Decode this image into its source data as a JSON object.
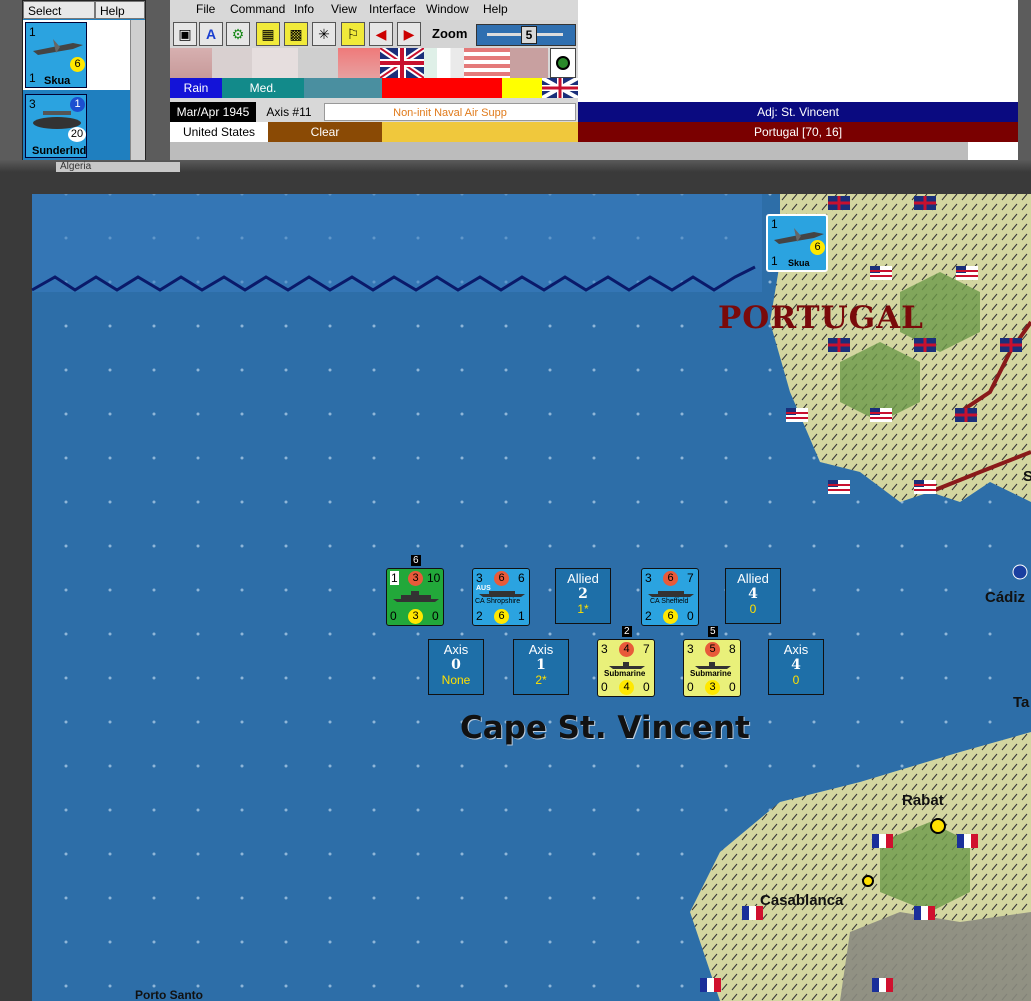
{
  "select_panel": {
    "select_label": "Select",
    "help_label": "Help",
    "units": [
      {
        "name": "Skua",
        "top_left": "1",
        "bottom_left": "1",
        "badge": "6"
      },
      {
        "name": "Sunderlnd",
        "top_left": "3",
        "top_right": "1",
        "badge": "20"
      }
    ]
  },
  "menubar": [
    "File",
    "Command",
    "Info",
    "View",
    "Interface",
    "Window",
    "Help"
  ],
  "toolbar": {
    "zoom_label": "Zoom",
    "zoom_value": "5"
  },
  "weather": {
    "condition": "Rain",
    "zone": "Med."
  },
  "status": {
    "date": "Mar/Apr 1945",
    "turn": "Axis #11",
    "phase": "Non-init Naval Air Supp",
    "adjacent": "Adj: St. Vincent",
    "country": "United States",
    "terrain": "Clear",
    "location": "Portugal [70, 16]"
  },
  "tab_label": "Algeria",
  "map_labels": {
    "country": "PORTUGAL",
    "sea_zone": "Cape St. Vincent",
    "cities": [
      "Rabat",
      "Casablanca",
      "Cádiz",
      "Porto Santo"
    ],
    "partial": [
      "S",
      "Ta"
    ]
  },
  "map_unit": {
    "name": "Skua",
    "top_left": "1",
    "bottom_left": "1",
    "badge": "6"
  },
  "boxes": [
    {
      "side": "Allied",
      "value": "2",
      "extra": "1*"
    },
    {
      "side": "Allied",
      "value": "4",
      "extra": "0"
    },
    {
      "side": "Axis",
      "value": "0",
      "extra": "None"
    },
    {
      "side": "Axis",
      "value": "1",
      "extra": "2*"
    },
    {
      "side": "Axis",
      "value": "4",
      "extra": "0"
    }
  ],
  "ships": [
    {
      "name": "",
      "tl": "1",
      "tm": "3",
      "tr": "10",
      "bl": "0",
      "bm": "3",
      "br": "0",
      "stack": "6"
    },
    {
      "name": "CA Shropshire",
      "prefix": "AUS",
      "tl": "3",
      "tm": "6",
      "tr": "6",
      "bl": "2",
      "bm": "6",
      "br": "1"
    },
    {
      "name": "CA Sheffield",
      "tl": "3",
      "tm": "6",
      "tr": "7",
      "bl": "2",
      "bm": "6",
      "br": "0"
    },
    {
      "name": "Submarine",
      "tl": "3",
      "tm": "4",
      "tr": "7",
      "bl": "0",
      "bm": "4",
      "br": "0",
      "stack": "2"
    },
    {
      "name": "Submarine",
      "tl": "3",
      "tm": "5",
      "tr": "8",
      "bl": "0",
      "bm": "3",
      "br": "0",
      "stack": "5"
    }
  ]
}
